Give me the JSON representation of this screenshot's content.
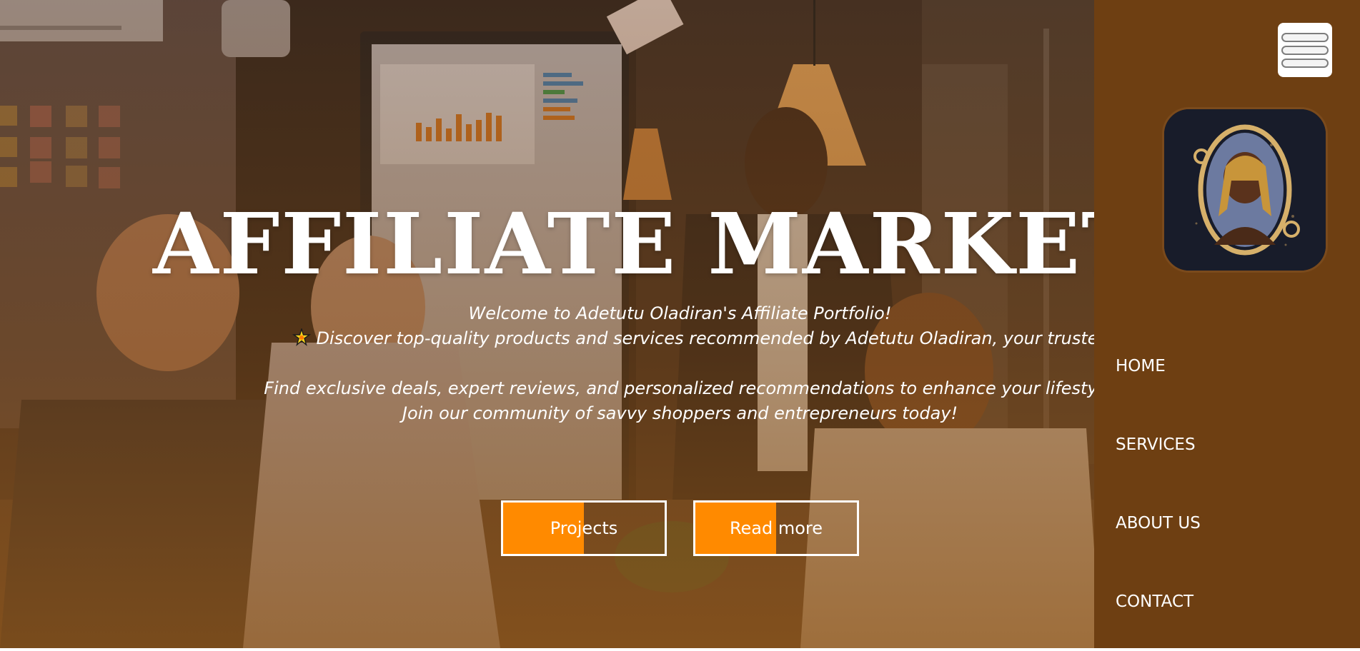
{
  "hero": {
    "title": "AFFILIATE MARKETING",
    "welcome": "Welcome to Adetutu Oladiran's Affiliate Portfolio!",
    "discover": "Discover top-quality products and services recommended by Adetutu Oladiran, your trusted affiliate partner.",
    "find": "Find exclusive deals, expert reviews, and personalized recommendations to enhance your lifestyle and business.",
    "join": "Join our community of savvy shoppers and entrepreneurs today!",
    "sparkle_icon": "sparkle-star-icon",
    "overlay_color": "#8c5418"
  },
  "buttons": {
    "projects": "Projects",
    "read_more": "Read more",
    "accent": "#ff8a00"
  },
  "sidebar": {
    "background": "#6e3f12",
    "menu_icon": "hamburger-menu-icon",
    "avatar_alt": "profile-avatar",
    "nav": [
      {
        "label": "HOME"
      },
      {
        "label": "SERVICES"
      },
      {
        "label": "ABOUT US"
      },
      {
        "label": "CONTACT"
      }
    ]
  }
}
